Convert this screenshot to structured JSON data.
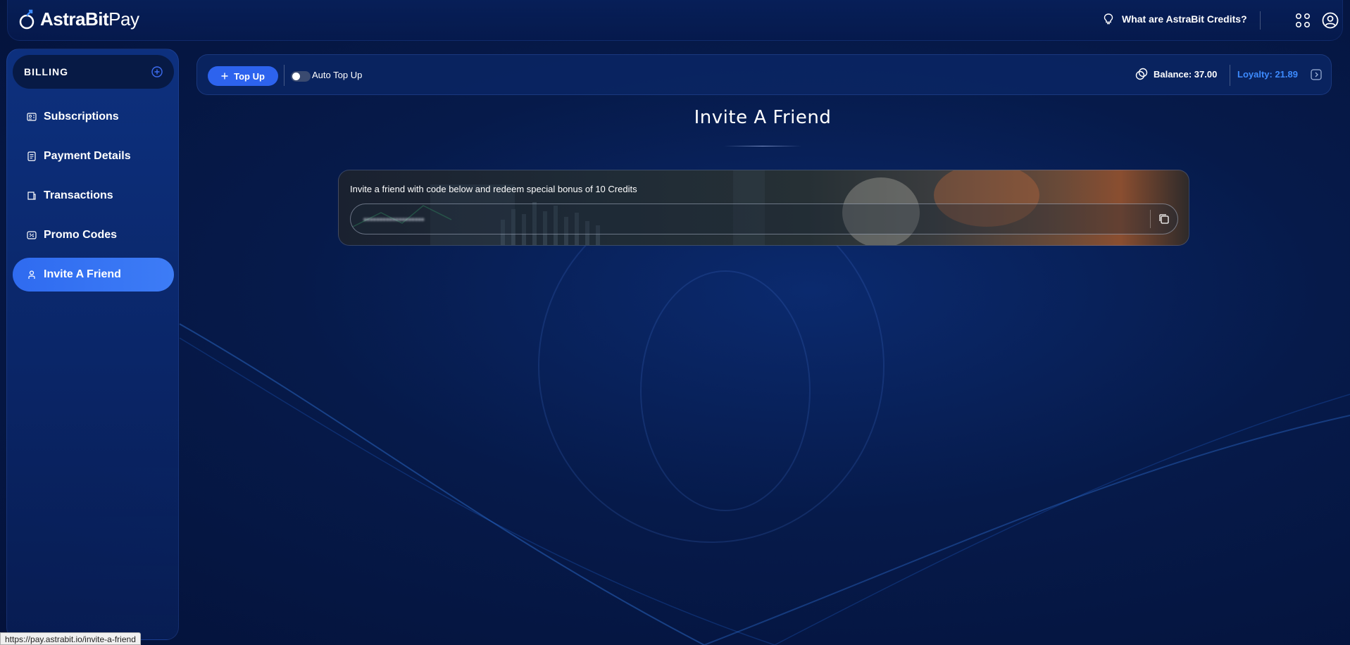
{
  "app": {
    "brand_bold": "AstraBit",
    "brand_light": "Pay"
  },
  "header": {
    "help_link": "What are AstraBit Credits?"
  },
  "sidebar": {
    "section": "BILLING",
    "items": [
      {
        "label": "Subscriptions",
        "icon": "id-card-icon"
      },
      {
        "label": "Payment Details",
        "icon": "document-icon"
      },
      {
        "label": "Transactions",
        "icon": "receipt-icon"
      },
      {
        "label": "Promo Codes",
        "icon": "ticket-icon"
      },
      {
        "label": "Invite A Friend",
        "icon": "user-icon",
        "active": true
      }
    ]
  },
  "topbar": {
    "topup_label": "Top Up",
    "auto_topup_label": "Auto Top Up",
    "auto_topup_enabled": false,
    "balance_label": "Balance: 37.00",
    "loyalty_label": "Loyalty: 21.89"
  },
  "main": {
    "title": "Invite A Friend",
    "invite_text": "Invite a friend with code below and redeem special bonus of 10 Credits",
    "code_value": "•••••••••••••••••••"
  },
  "statusbar": {
    "url": "https://pay.astrabit.io/invite-a-friend"
  },
  "colors": {
    "accent": "#2d63ee",
    "loyalty": "#3d8bff",
    "background": "#061a4a"
  }
}
